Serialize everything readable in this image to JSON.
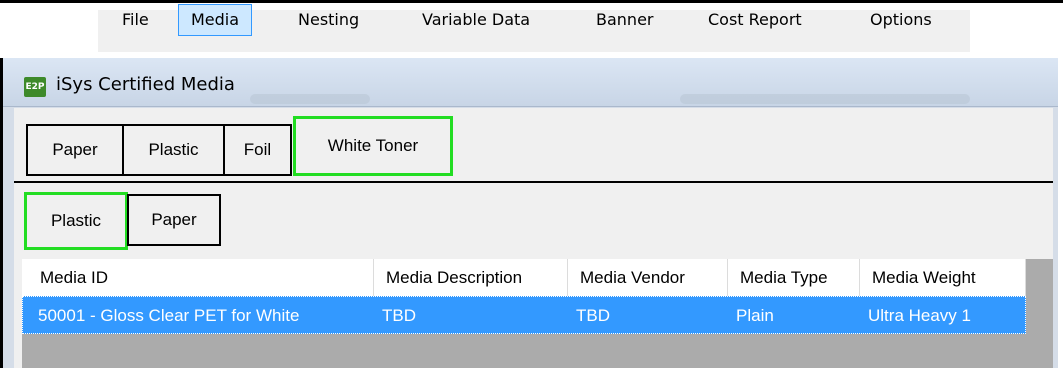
{
  "menubar": {
    "items": [
      {
        "label": "File"
      },
      {
        "label": "Media"
      },
      {
        "label": "Nesting"
      },
      {
        "label": "Variable Data"
      },
      {
        "label": "Banner"
      },
      {
        "label": "Cost Report"
      },
      {
        "label": "Options"
      }
    ],
    "active": "Media"
  },
  "window": {
    "icon_text": "E2P",
    "title": "iSys Certified Media"
  },
  "category_tabs": [
    {
      "label": "Paper"
    },
    {
      "label": "Plastic"
    },
    {
      "label": "Foil"
    },
    {
      "label": "White Toner"
    }
  ],
  "category_selected": "White Toner",
  "sub_tabs": [
    {
      "label": "Plastic"
    },
    {
      "label": "Paper"
    }
  ],
  "sub_selected": "Plastic",
  "grid": {
    "columns": [
      "Media ID",
      "Media Description",
      "Media Vendor",
      "Media Type",
      "Media Weight"
    ],
    "rows": [
      [
        "50001 - Gloss Clear PET for White",
        "TBD",
        "TBD",
        "Plain",
        "Ultra Heavy 1"
      ]
    ],
    "selected_row": 0
  },
  "colors": {
    "selection": "#3399ff",
    "tab_highlight": "#22dd22",
    "menu_active": "#cde8ff"
  }
}
